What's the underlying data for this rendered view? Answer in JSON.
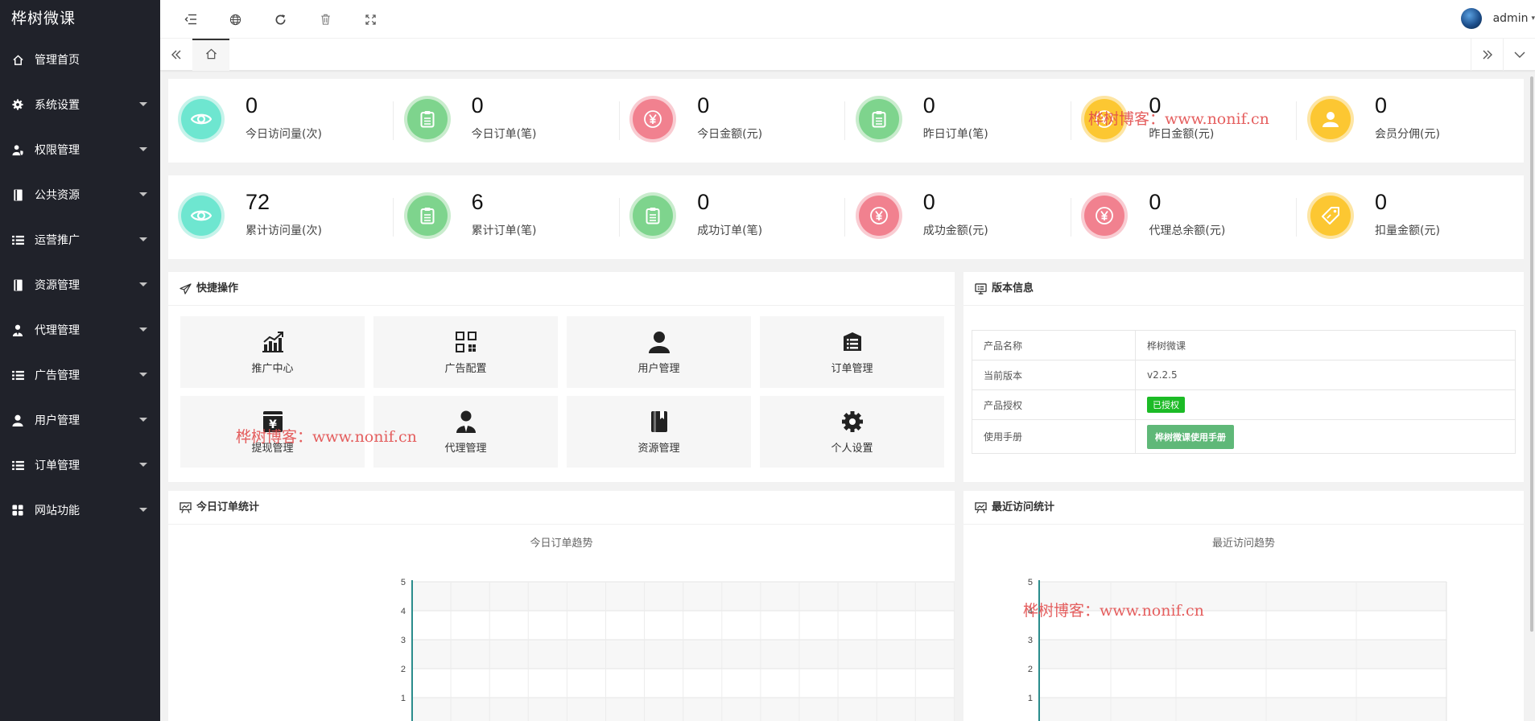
{
  "app": {
    "title": "桦树微课"
  },
  "sidebar": {
    "items": [
      {
        "label": "管理首页",
        "icon": "home-icon",
        "has_arrow": false
      },
      {
        "label": "系统设置",
        "icon": "gear-icon",
        "has_arrow": true
      },
      {
        "label": "权限管理",
        "icon": "user-shield-icon",
        "has_arrow": true
      },
      {
        "label": "公共资源",
        "icon": "book-icon",
        "has_arrow": true
      },
      {
        "label": "运营推广",
        "icon": "list-icon",
        "has_arrow": true
      },
      {
        "label": "资源管理",
        "icon": "book-icon",
        "has_arrow": true
      },
      {
        "label": "代理管理",
        "icon": "user-tie-icon",
        "has_arrow": true
      },
      {
        "label": "广告管理",
        "icon": "list-icon",
        "has_arrow": true
      },
      {
        "label": "用户管理",
        "icon": "user-icon",
        "has_arrow": true
      },
      {
        "label": "订单管理",
        "icon": "list-icon",
        "has_arrow": true
      },
      {
        "label": "网站功能",
        "icon": "grid-icon",
        "has_arrow": true
      }
    ]
  },
  "header": {
    "username": "admin"
  },
  "stats_row1": [
    {
      "value": "0",
      "label": "今日访问量(次)",
      "color": "teal",
      "icon": "eye-icon"
    },
    {
      "value": "0",
      "label": "今日订单(笔)",
      "color": "green",
      "icon": "clipboard-icon"
    },
    {
      "value": "0",
      "label": "今日金额(元)",
      "color": "red",
      "icon": "yen-icon"
    },
    {
      "value": "0",
      "label": "昨日订单(笔)",
      "color": "green",
      "icon": "clipboard-icon"
    },
    {
      "value": "0",
      "label": "昨日金额(元)",
      "color": "yellow",
      "icon": "yen-icon"
    },
    {
      "value": "0",
      "label": "会员分佣(元)",
      "color": "yellow",
      "icon": "user-icon"
    }
  ],
  "stats_row2": [
    {
      "value": "72",
      "label": "累计访问量(次)",
      "color": "teal",
      "icon": "eye-icon"
    },
    {
      "value": "6",
      "label": "累计订单(笔)",
      "color": "green",
      "icon": "clipboard-icon"
    },
    {
      "value": "0",
      "label": "成功订单(笔)",
      "color": "green",
      "icon": "clipboard-icon"
    },
    {
      "value": "0",
      "label": "成功金额(元)",
      "color": "red",
      "icon": "yen-icon"
    },
    {
      "value": "0",
      "label": "代理总余额(元)",
      "color": "red",
      "icon": "yen-icon"
    },
    {
      "value": "0",
      "label": "扣量金额(元)",
      "color": "yellow",
      "icon": "tag-icon"
    }
  ],
  "quick_ops": {
    "title": "快捷操作",
    "items": [
      {
        "label": "推广中心",
        "icon": "chart-growth-icon"
      },
      {
        "label": "广告配置",
        "icon": "qrcode-icon"
      },
      {
        "label": "用户管理",
        "icon": "user-icon"
      },
      {
        "label": "订单管理",
        "icon": "list-box-icon"
      },
      {
        "label": "提现管理",
        "icon": "yen-card-icon"
      },
      {
        "label": "代理管理",
        "icon": "user-tie-icon"
      },
      {
        "label": "资源管理",
        "icon": "book-icon"
      },
      {
        "label": "个人设置",
        "icon": "gear-icon"
      }
    ]
  },
  "version_info": {
    "title": "版本信息",
    "rows": [
      {
        "key": "产品名称",
        "value": "桦树微课"
      },
      {
        "key": "当前版本",
        "value": "v2.2.5"
      },
      {
        "key": "产品授权",
        "value": "已授权"
      },
      {
        "key": "使用手册",
        "value": "桦树微课使用手册"
      }
    ]
  },
  "order_stats": {
    "title": "今日订单统计",
    "chart_title": "今日订单趋势"
  },
  "visit_stats": {
    "title": "最近访问统计",
    "chart_title": "最近访问趋势"
  },
  "chart_data": [
    {
      "type": "line",
      "title": "今日订单趋势",
      "yticks": [
        "1",
        "2",
        "3",
        "4",
        "5"
      ],
      "ylim": [
        0,
        5
      ],
      "grid": true,
      "series": [
        {
          "values": []
        }
      ]
    },
    {
      "type": "line",
      "title": "最近访问趋势",
      "yticks": [
        "1",
        "2",
        "3",
        "4",
        "5"
      ],
      "ylim": [
        0,
        5
      ],
      "grid": true,
      "series": [
        {
          "values": []
        }
      ]
    }
  ],
  "watermarks": [
    "桦树博客：www.nonif.cn",
    "桦树博客：www.nonif.cn",
    "桦树博客：www.nonif.cn"
  ],
  "colors": {
    "sidebar_bg": "#20222a",
    "teal": "#6ee6d0",
    "green": "#7ed48d",
    "red": "#f1818f",
    "yellow": "#fcc732",
    "accent_green": "#5fb878",
    "badge_green": "#1cbb26",
    "axis_teal": "#2a8c8c"
  }
}
